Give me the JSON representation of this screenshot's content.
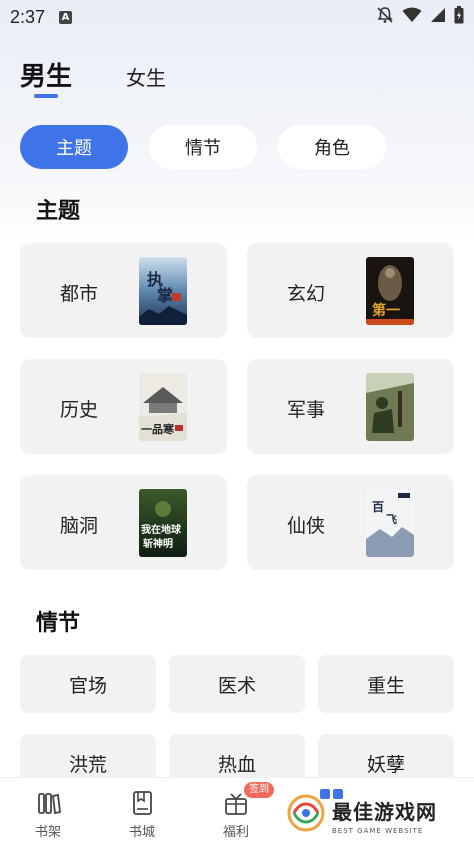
{
  "status_bar": {
    "time": "2:37",
    "notification_icon": "A"
  },
  "gender_tabs": {
    "active": "男生",
    "inactive": "女生"
  },
  "filters": [
    "主题",
    "情节",
    "角色"
  ],
  "theme_section": {
    "title": "主题",
    "items": [
      {
        "label": "都市",
        "cover_text": "执掌"
      },
      {
        "label": "玄幻",
        "cover_text": "第一神"
      },
      {
        "label": "历史",
        "cover_text": "一品寒门"
      },
      {
        "label": "军事",
        "cover_text": ""
      },
      {
        "label": "脑洞",
        "cover_text": "我在地球斩神明"
      },
      {
        "label": "仙侠",
        "cover_text": "百炼飞升录"
      }
    ]
  },
  "plot_section": {
    "title": "情节",
    "items": [
      "官场",
      "医术",
      "重生",
      "洪荒",
      "热血",
      "妖孽"
    ]
  },
  "tab_bar": {
    "items": [
      {
        "label": "书架",
        "icon": "bookshelf-icon"
      },
      {
        "label": "书城",
        "icon": "book-icon"
      },
      {
        "label": "福利",
        "icon": "gift-icon"
      }
    ],
    "sign_badge": "签到"
  },
  "watermark": {
    "title": "最佳游戏网",
    "subtitle": "BEST GAME WEBSITE"
  },
  "colors": {
    "accent": "#3f73e8",
    "card_bg": "#f2f2f2",
    "badge": "#f26a5a"
  }
}
